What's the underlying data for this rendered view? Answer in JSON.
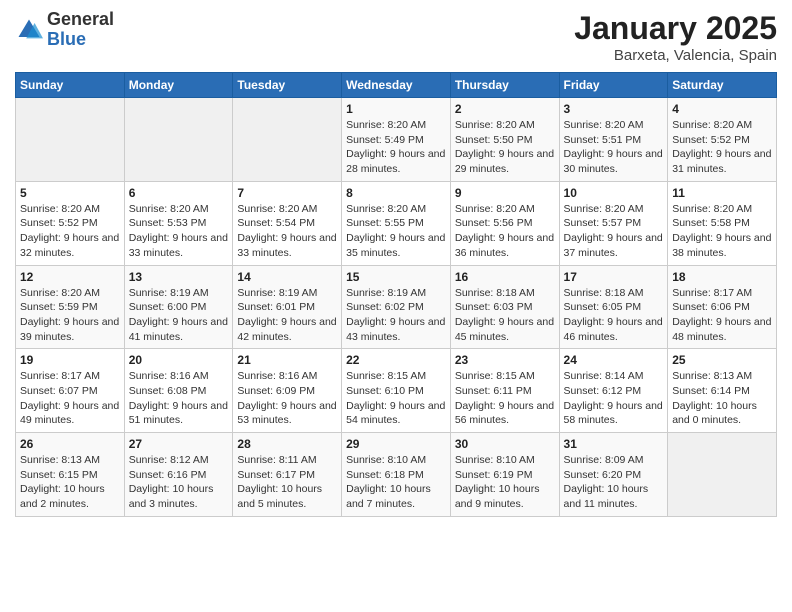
{
  "header": {
    "logo": {
      "general": "General",
      "blue": "Blue"
    },
    "title": "January 2025",
    "subtitle": "Barxeta, Valencia, Spain"
  },
  "days_of_week": [
    "Sunday",
    "Monday",
    "Tuesday",
    "Wednesday",
    "Thursday",
    "Friday",
    "Saturday"
  ],
  "weeks": [
    [
      {
        "day": "",
        "info": ""
      },
      {
        "day": "",
        "info": ""
      },
      {
        "day": "",
        "info": ""
      },
      {
        "day": "1",
        "info": "Sunrise: 8:20 AM\nSunset: 5:49 PM\nDaylight: 9 hours and 28 minutes."
      },
      {
        "day": "2",
        "info": "Sunrise: 8:20 AM\nSunset: 5:50 PM\nDaylight: 9 hours and 29 minutes."
      },
      {
        "day": "3",
        "info": "Sunrise: 8:20 AM\nSunset: 5:51 PM\nDaylight: 9 hours and 30 minutes."
      },
      {
        "day": "4",
        "info": "Sunrise: 8:20 AM\nSunset: 5:52 PM\nDaylight: 9 hours and 31 minutes."
      }
    ],
    [
      {
        "day": "5",
        "info": "Sunrise: 8:20 AM\nSunset: 5:52 PM\nDaylight: 9 hours and 32 minutes."
      },
      {
        "day": "6",
        "info": "Sunrise: 8:20 AM\nSunset: 5:53 PM\nDaylight: 9 hours and 33 minutes."
      },
      {
        "day": "7",
        "info": "Sunrise: 8:20 AM\nSunset: 5:54 PM\nDaylight: 9 hours and 33 minutes."
      },
      {
        "day": "8",
        "info": "Sunrise: 8:20 AM\nSunset: 5:55 PM\nDaylight: 9 hours and 35 minutes."
      },
      {
        "day": "9",
        "info": "Sunrise: 8:20 AM\nSunset: 5:56 PM\nDaylight: 9 hours and 36 minutes."
      },
      {
        "day": "10",
        "info": "Sunrise: 8:20 AM\nSunset: 5:57 PM\nDaylight: 9 hours and 37 minutes."
      },
      {
        "day": "11",
        "info": "Sunrise: 8:20 AM\nSunset: 5:58 PM\nDaylight: 9 hours and 38 minutes."
      }
    ],
    [
      {
        "day": "12",
        "info": "Sunrise: 8:20 AM\nSunset: 5:59 PM\nDaylight: 9 hours and 39 minutes."
      },
      {
        "day": "13",
        "info": "Sunrise: 8:19 AM\nSunset: 6:00 PM\nDaylight: 9 hours and 41 minutes."
      },
      {
        "day": "14",
        "info": "Sunrise: 8:19 AM\nSunset: 6:01 PM\nDaylight: 9 hours and 42 minutes."
      },
      {
        "day": "15",
        "info": "Sunrise: 8:19 AM\nSunset: 6:02 PM\nDaylight: 9 hours and 43 minutes."
      },
      {
        "day": "16",
        "info": "Sunrise: 8:18 AM\nSunset: 6:03 PM\nDaylight: 9 hours and 45 minutes."
      },
      {
        "day": "17",
        "info": "Sunrise: 8:18 AM\nSunset: 6:05 PM\nDaylight: 9 hours and 46 minutes."
      },
      {
        "day": "18",
        "info": "Sunrise: 8:17 AM\nSunset: 6:06 PM\nDaylight: 9 hours and 48 minutes."
      }
    ],
    [
      {
        "day": "19",
        "info": "Sunrise: 8:17 AM\nSunset: 6:07 PM\nDaylight: 9 hours and 49 minutes."
      },
      {
        "day": "20",
        "info": "Sunrise: 8:16 AM\nSunset: 6:08 PM\nDaylight: 9 hours and 51 minutes."
      },
      {
        "day": "21",
        "info": "Sunrise: 8:16 AM\nSunset: 6:09 PM\nDaylight: 9 hours and 53 minutes."
      },
      {
        "day": "22",
        "info": "Sunrise: 8:15 AM\nSunset: 6:10 PM\nDaylight: 9 hours and 54 minutes."
      },
      {
        "day": "23",
        "info": "Sunrise: 8:15 AM\nSunset: 6:11 PM\nDaylight: 9 hours and 56 minutes."
      },
      {
        "day": "24",
        "info": "Sunrise: 8:14 AM\nSunset: 6:12 PM\nDaylight: 9 hours and 58 minutes."
      },
      {
        "day": "25",
        "info": "Sunrise: 8:13 AM\nSunset: 6:14 PM\nDaylight: 10 hours and 0 minutes."
      }
    ],
    [
      {
        "day": "26",
        "info": "Sunrise: 8:13 AM\nSunset: 6:15 PM\nDaylight: 10 hours and 2 minutes."
      },
      {
        "day": "27",
        "info": "Sunrise: 8:12 AM\nSunset: 6:16 PM\nDaylight: 10 hours and 3 minutes."
      },
      {
        "day": "28",
        "info": "Sunrise: 8:11 AM\nSunset: 6:17 PM\nDaylight: 10 hours and 5 minutes."
      },
      {
        "day": "29",
        "info": "Sunrise: 8:10 AM\nSunset: 6:18 PM\nDaylight: 10 hours and 7 minutes."
      },
      {
        "day": "30",
        "info": "Sunrise: 8:10 AM\nSunset: 6:19 PM\nDaylight: 10 hours and 9 minutes."
      },
      {
        "day": "31",
        "info": "Sunrise: 8:09 AM\nSunset: 6:20 PM\nDaylight: 10 hours and 11 minutes."
      },
      {
        "day": "",
        "info": ""
      }
    ]
  ]
}
